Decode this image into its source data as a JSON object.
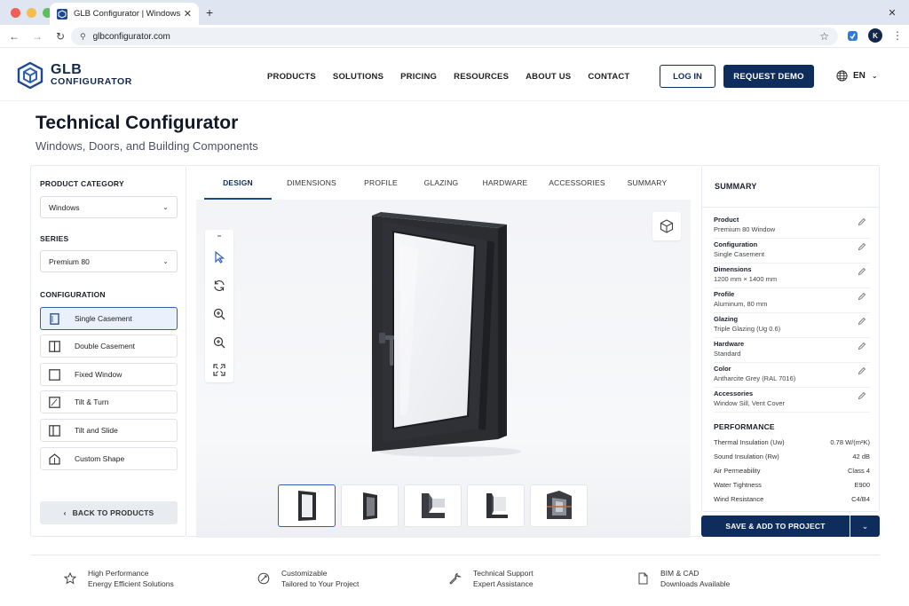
{
  "browser": {
    "tab_title": "GLB Configurator | Windows, Doors",
    "url": "glbconfigurator.com",
    "profile_initial": "K",
    "traffic_colors": [
      "#ee5f57",
      "#f5bd4f",
      "#5ac05a"
    ]
  },
  "header": {
    "logo_line1": "GLB",
    "logo_line2": "CONFIGURATOR",
    "nav": [
      "PRODUCTS",
      "SOLUTIONS",
      "PRICING",
      "RESOURCES",
      "ABOUT US",
      "CONTACT"
    ],
    "login_label": "LOG IN",
    "demo_label": "REQUEST DEMO",
    "language": "EN"
  },
  "page": {
    "title": "Technical Configurator",
    "subtitle": "Windows, Doors, and Building Components"
  },
  "left_panel": {
    "category_label": "PRODUCT CATEGORY",
    "category_value": "Windows",
    "series_label": "SERIES",
    "series_value": "Premium 80",
    "configuration_label": "CONFIGURATION",
    "configurations": [
      {
        "label": "Single Casement",
        "icon": "single-casement-icon",
        "active": true
      },
      {
        "label": "Double Casement",
        "icon": "double-casement-icon",
        "active": false
      },
      {
        "label": "Fixed Window",
        "icon": "fixed-window-icon",
        "active": false
      },
      {
        "label": "Tilt & Turn",
        "icon": "tilt-turn-icon",
        "active": false
      },
      {
        "label": "Tilt and Slide",
        "icon": "tilt-slide-icon",
        "active": false
      },
      {
        "label": "Custom Shape",
        "icon": "custom-shape-icon",
        "active": false
      }
    ],
    "back_label": "BACK TO PRODUCTS"
  },
  "tabs": [
    {
      "label": "DESIGN",
      "active": true
    },
    {
      "label": "DIMENSIONS",
      "active": false
    },
    {
      "label": "PROFILE",
      "active": false
    },
    {
      "label": "GLAZING",
      "active": false
    },
    {
      "label": "HARDWARE",
      "active": false
    },
    {
      "label": "ACCESSORIES",
      "active": false
    },
    {
      "label": "SUMMARY",
      "active": false
    }
  ],
  "viewer": {
    "tools": [
      "minimize-icon",
      "select-icon",
      "rotate-icon",
      "zoom-in-icon",
      "zoom-out-icon",
      "fullscreen-icon"
    ]
  },
  "summary": {
    "title": "SUMMARY",
    "rows": [
      {
        "key": "Product",
        "value": "Premium 80 Window"
      },
      {
        "key": "Configuration",
        "value": "Single Casement"
      },
      {
        "key": "Dimensions",
        "value": "1200 mm × 1400 mm"
      },
      {
        "key": "Profile",
        "value": "Aluminum, 80 mm"
      },
      {
        "key": "Glazing",
        "value": "Triple Glazing (Ug 0.6)"
      },
      {
        "key": "Hardware",
        "value": "Standard"
      },
      {
        "key": "Color",
        "value": "Antharcite Grey (RAL 7016)"
      },
      {
        "key": "Accessories",
        "value": "Window Sill, Vent Cover"
      }
    ],
    "performance_title": "PERFORMANCE",
    "performance": [
      {
        "key": "Thermal Insulation (Uw)",
        "value": "0.78 W/(m²K)"
      },
      {
        "key": "Sound Insulation (Rw)",
        "value": "42 dB"
      },
      {
        "key": "Air Permeability",
        "value": "Class 4"
      },
      {
        "key": "Water Tightness",
        "value": "E900"
      },
      {
        "key": "Wind Resistance",
        "value": "C4/B4"
      }
    ],
    "save_label": "SAVE & ADD TO PROJECT"
  },
  "features": [
    {
      "icon": "star-icon",
      "line1": "High Performance",
      "line2": "Energy Efficient Solutions"
    },
    {
      "icon": "customize-icon",
      "line1": "Customizable",
      "line2": "Tailored to Your Project"
    },
    {
      "icon": "wrench-icon",
      "line1": "Technical Support",
      "line2": "Expert Assistance"
    },
    {
      "icon": "document-icon",
      "line1": "BIM & CAD",
      "line2": "Downloads Available"
    }
  ],
  "colors": {
    "brand_navy": "#0f2d5c",
    "accent_blue": "#2f62b5",
    "window_frame": "#2b2d31"
  }
}
